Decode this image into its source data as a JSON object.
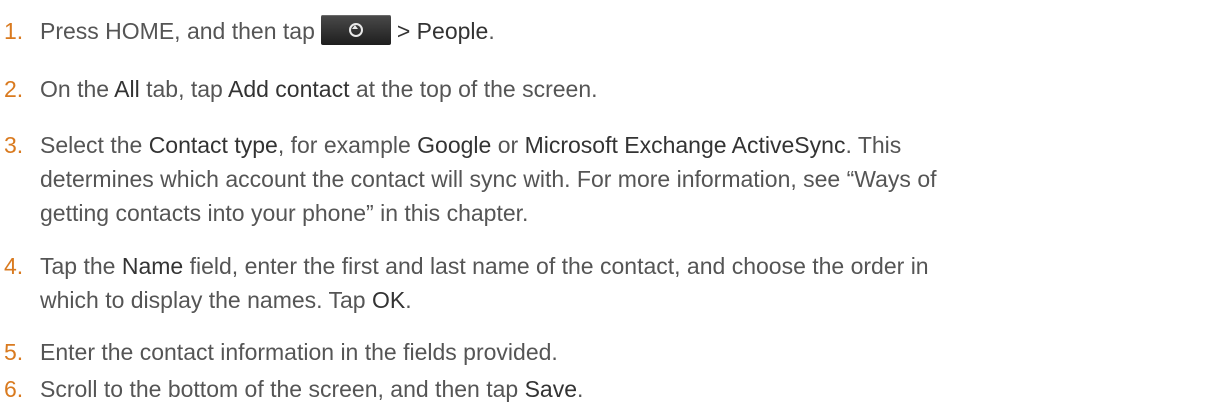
{
  "steps": [
    {
      "number": "1.",
      "parts": {
        "a": "Press HOME, and then tap",
        "b": "> People",
        "c": "."
      },
      "icon": "all-apps-icon"
    },
    {
      "number": "2.",
      "parts": {
        "a": "On the ",
        "b": "All",
        "c": " tab, tap ",
        "d": "Add contact",
        "e": " at the top of the screen."
      }
    },
    {
      "number": "3.",
      "lines": {
        "l1a": "Select the ",
        "l1b": "Contact type",
        "l1c": ", for example ",
        "l1d": "Google",
        "l1e": " or ",
        "l1f": "Microsoft Exchange ActiveSync",
        "l1g": ". This",
        "l2": "determines which account the contact will sync with. For more information, see “Ways of",
        "l3": "getting contacts into your phone” in this chapter."
      }
    },
    {
      "number": "4.",
      "lines": {
        "l1a": "Tap the ",
        "l1b": "Name",
        "l1c": " field, enter the first and last name of the contact, and choose the order in",
        "l2a": "which to display the names. Tap ",
        "l2b": "OK",
        "l2c": "."
      }
    },
    {
      "number": "5.",
      "text": "Enter the contact information in the fields provided."
    },
    {
      "number": "6.",
      "parts": {
        "a": "Scroll to the bottom of the screen, and then tap ",
        "b": "Save",
        "c": "."
      }
    }
  ],
  "colors": {
    "number": "#d97a1f",
    "text": "#555555",
    "emphasis": "#333333"
  }
}
